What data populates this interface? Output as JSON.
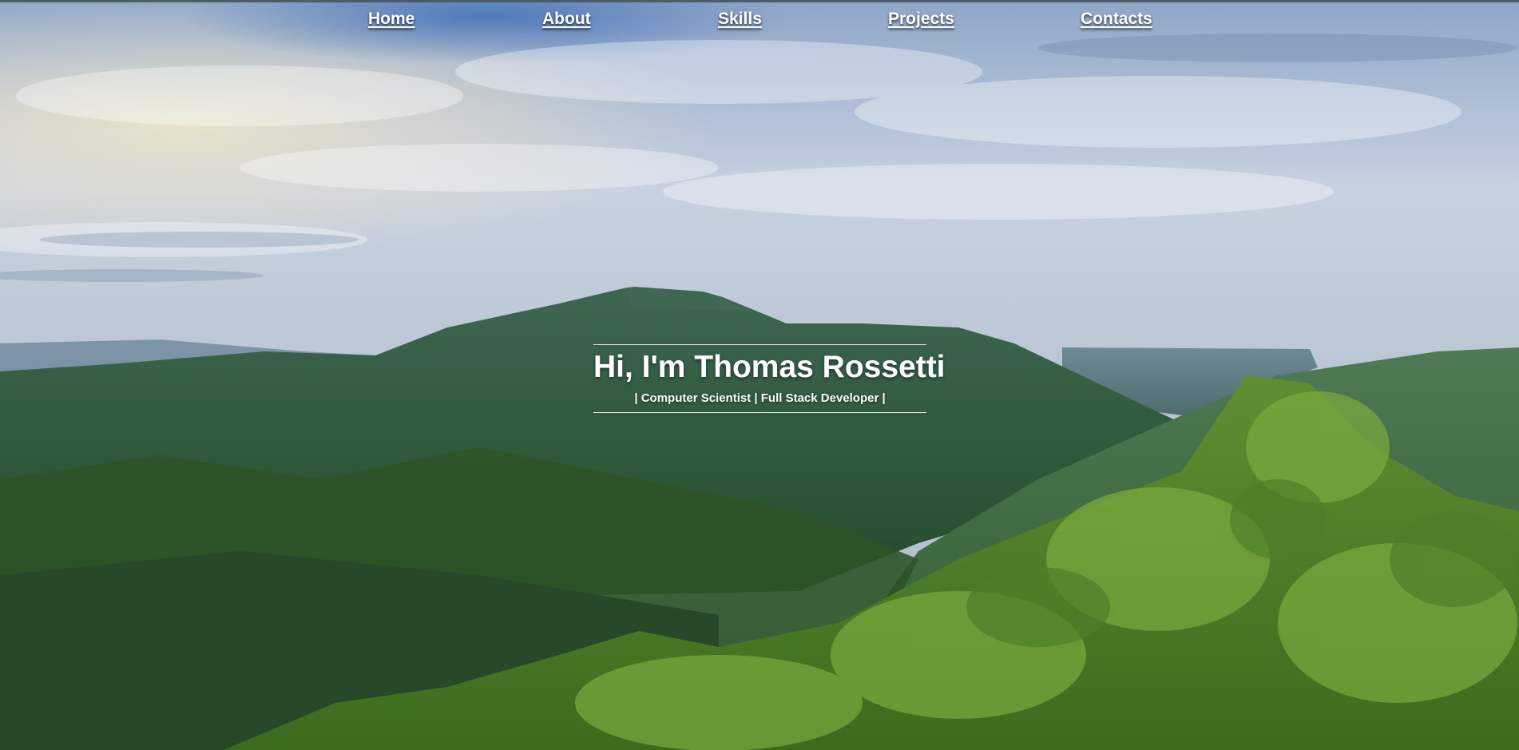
{
  "nav": {
    "items": [
      {
        "label": "Home"
      },
      {
        "label": "About"
      },
      {
        "label": "Skills"
      },
      {
        "label": "Projects"
      },
      {
        "label": "Contacts"
      }
    ]
  },
  "hero": {
    "title": "Hi, I'm Thomas Rossetti",
    "subtitle": "| Computer Scientist | Full Stack Developer |",
    "background_image": "mountain-valley-landscape",
    "colors": {
      "sky_light": "#d7dde6",
      "sky_blue": "#6f8cb8",
      "haze": "#aebfce",
      "mountain_far": "#5e7e8a",
      "forest_dark": "#2f5a34",
      "forest_bright": "#6b9a3a"
    }
  }
}
